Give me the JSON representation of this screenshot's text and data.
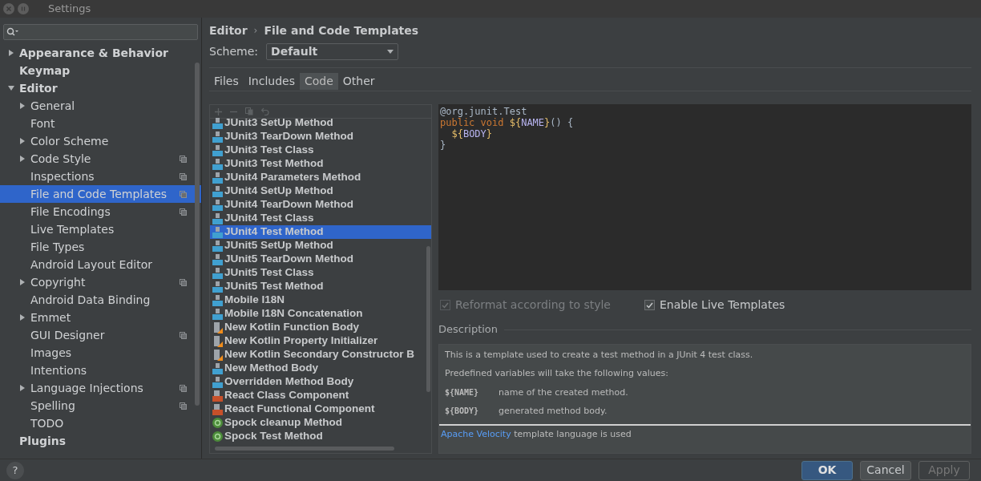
{
  "window": {
    "title": "Settings"
  },
  "tree": [
    {
      "label": "Appearance & Behavior",
      "expanded": false,
      "selected": false,
      "shared": false
    },
    {
      "label": "Keymap",
      "selected": false,
      "shared": false
    },
    {
      "label": "Editor",
      "expanded": true,
      "selected": false,
      "shared": false,
      "children": [
        {
          "label": "General",
          "expanded": false,
          "selected": false,
          "shared": false
        },
        {
          "label": "Font",
          "selected": false,
          "shared": false
        },
        {
          "label": "Color Scheme",
          "expanded": false,
          "selected": false,
          "shared": false
        },
        {
          "label": "Code Style",
          "expanded": false,
          "selected": false,
          "shared": true
        },
        {
          "label": "Inspections",
          "selected": false,
          "shared": true
        },
        {
          "label": "File and Code Templates",
          "selected": true,
          "shared": true
        },
        {
          "label": "File Encodings",
          "selected": false,
          "shared": true
        },
        {
          "label": "Live Templates",
          "selected": false,
          "shared": false
        },
        {
          "label": "File Types",
          "selected": false,
          "shared": false
        },
        {
          "label": "Android Layout Editor",
          "selected": false,
          "shared": false
        },
        {
          "label": "Copyright",
          "expanded": false,
          "selected": false,
          "shared": true
        },
        {
          "label": "Android Data Binding",
          "selected": false,
          "shared": false
        },
        {
          "label": "Emmet",
          "expanded": false,
          "selected": false,
          "shared": false
        },
        {
          "label": "GUI Designer",
          "selected": false,
          "shared": true
        },
        {
          "label": "Images",
          "selected": false,
          "shared": false
        },
        {
          "label": "Intentions",
          "selected": false,
          "shared": false
        },
        {
          "label": "Language Injections",
          "expanded": false,
          "selected": false,
          "shared": true
        },
        {
          "label": "Spelling",
          "selected": false,
          "shared": true
        },
        {
          "label": "TODO",
          "selected": false,
          "shared": false
        }
      ]
    },
    {
      "label": "Plugins",
      "selected": false,
      "shared": false
    }
  ],
  "breadcrumb": {
    "parent": "Editor",
    "separator": "›",
    "current": "File and Code Templates"
  },
  "scheme": {
    "label": "Scheme:",
    "value": "Default"
  },
  "tabs": [
    {
      "label": "Files",
      "selected": false
    },
    {
      "label": "Includes",
      "selected": false
    },
    {
      "label": "Code",
      "selected": true
    },
    {
      "label": "Other",
      "selected": false
    }
  ],
  "templates": [
    {
      "name": "JUnit3 SetUp Method",
      "kind": "junit",
      "selected": false
    },
    {
      "name": "JUnit3 TearDown Method",
      "kind": "junit",
      "selected": false
    },
    {
      "name": "JUnit3 Test Class",
      "kind": "junit",
      "selected": false
    },
    {
      "name": "JUnit3 Test Method",
      "kind": "junit",
      "selected": false
    },
    {
      "name": "JUnit4 Parameters Method",
      "kind": "junit",
      "selected": false
    },
    {
      "name": "JUnit4 SetUp Method",
      "kind": "junit",
      "selected": false
    },
    {
      "name": "JUnit4 TearDown Method",
      "kind": "junit",
      "selected": false
    },
    {
      "name": "JUnit4 Test Class",
      "kind": "junit",
      "selected": false
    },
    {
      "name": "JUnit4 Test Method",
      "kind": "junit",
      "selected": true
    },
    {
      "name": "JUnit5 SetUp Method",
      "kind": "junit",
      "selected": false
    },
    {
      "name": "JUnit5 TearDown Method",
      "kind": "junit",
      "selected": false
    },
    {
      "name": "JUnit5 Test Class",
      "kind": "junit",
      "selected": false
    },
    {
      "name": "JUnit5 Test Method",
      "kind": "junit",
      "selected": false
    },
    {
      "name": "Mobile I18N",
      "kind": "junit",
      "selected": false
    },
    {
      "name": "Mobile I18N Concatenation",
      "kind": "junit",
      "selected": false
    },
    {
      "name": "New Kotlin Function Body",
      "kind": "kotlin",
      "selected": false
    },
    {
      "name": "New Kotlin Property Initializer",
      "kind": "kotlin",
      "selected": false
    },
    {
      "name": "New Kotlin Secondary Constructor B",
      "kind": "kotlin",
      "selected": false
    },
    {
      "name": "New Method Body",
      "kind": "junit",
      "selected": false
    },
    {
      "name": "Overridden Method Body",
      "kind": "junit",
      "selected": false
    },
    {
      "name": "React Class Component",
      "kind": "jsx",
      "selected": false
    },
    {
      "name": "React Functional Component",
      "kind": "jsx",
      "selected": false
    },
    {
      "name": "Spock cleanup Method",
      "kind": "groovy",
      "selected": false
    },
    {
      "name": "Spock Test Method",
      "kind": "groovy",
      "selected": false
    }
  ],
  "code": [
    [
      {
        "text": "@org.junit.Test",
        "kind": "plain"
      }
    ],
    [
      {
        "text": "public void ",
        "kind": "keyword"
      },
      {
        "text": "${",
        "kind": "brace"
      },
      {
        "text": "NAME",
        "kind": "var"
      },
      {
        "text": "}",
        "kind": "brace"
      },
      {
        "text": "() {",
        "kind": "plain"
      }
    ],
    [
      {
        "text": "  ${",
        "kind": "brace"
      },
      {
        "text": "BODY",
        "kind": "var"
      },
      {
        "text": "}",
        "kind": "brace"
      }
    ],
    [
      {
        "text": "}",
        "kind": "plain"
      }
    ]
  ],
  "options": [
    {
      "label": "Reformat according to style",
      "checked": true,
      "disabled": true
    },
    {
      "label": "Enable Live Templates",
      "checked": true,
      "disabled": false
    }
  ],
  "description": {
    "heading": "Description",
    "lines": [
      "This is a template used to create a test method in a JUnit 4 test class.",
      "Predefined variables will take the following values:"
    ],
    "variables": [
      {
        "name": "${NAME}",
        "meaning": "name of the created method."
      },
      {
        "name": "${BODY}",
        "meaning": "generated method body."
      }
    ],
    "link": "Apache Velocity",
    "footer": "template language is used"
  },
  "help": "?",
  "buttons": [
    {
      "label": "OK",
      "kind": "primary"
    },
    {
      "label": "Cancel",
      "kind": "normal"
    },
    {
      "label": "Apply",
      "kind": "disabled"
    }
  ]
}
